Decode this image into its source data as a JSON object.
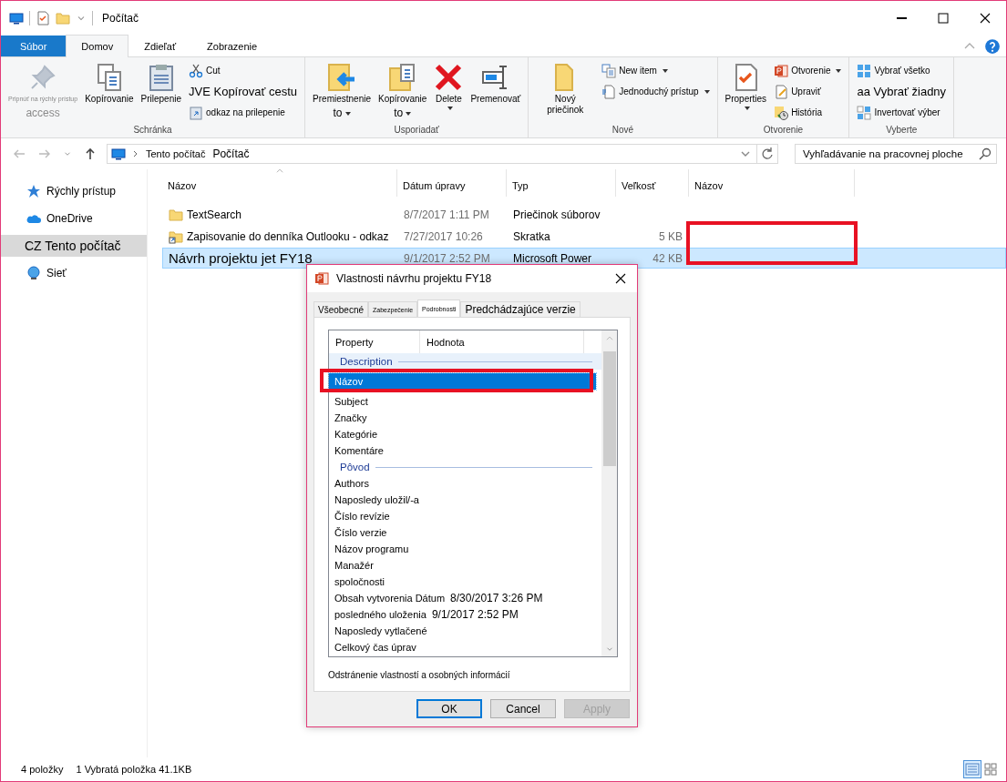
{
  "window": {
    "title": "Počítač"
  },
  "ribbon": {
    "tabs": [
      {
        "label": "Súbor",
        "kind": "file",
        "selected": false
      },
      {
        "label": "Domov",
        "kind": "tab",
        "selected": true
      },
      {
        "label": "Zdieľať",
        "kind": "tab",
        "selected": false
      },
      {
        "label": "Zobrazenie",
        "kind": "tab",
        "selected": false
      }
    ],
    "groups": [
      {
        "name": "Schránka",
        "items": [
          {
            "kind": "large",
            "label": "Pripnúť na rýchly prístup",
            "sublabel": "access",
            "dropdown": false,
            "disabled": true
          },
          {
            "kind": "large",
            "label": "Kopírovanie",
            "dropdown": false,
            "disabled": false
          },
          {
            "kind": "large",
            "label": "Prilepenie",
            "dropdown": false,
            "disabled": false
          },
          {
            "kind": "small",
            "label": "Cut",
            "dropdown": false,
            "disabled": false
          },
          {
            "kind": "small",
            "label": "JVE Kopírovať cestu",
            "dropdown": false,
            "disabled": false
          },
          {
            "kind": "small",
            "label": "odkaz na prilepenie",
            "dropdown": false,
            "disabled": false
          }
        ]
      },
      {
        "name": "Usporiadať",
        "items": [
          {
            "kind": "large",
            "label": "Premiestnenie",
            "sublabel": "to",
            "dropdown": true,
            "disabled": false
          },
          {
            "kind": "large",
            "label": "Kopírovanie",
            "sublabel": "to",
            "dropdown": true,
            "disabled": false
          },
          {
            "kind": "large",
            "label": "Delete",
            "dropdown": true,
            "disabled": false
          },
          {
            "kind": "large",
            "label": "Premenovať",
            "dropdown": false,
            "disabled": false
          }
        ]
      },
      {
        "name": "Nové",
        "items": [
          {
            "kind": "large",
            "label": "Nový priečinok",
            "dropdown": false,
            "disabled": false
          },
          {
            "kind": "small",
            "label": "New item",
            "dropdown": true,
            "disabled": false
          },
          {
            "kind": "small",
            "label": "Jednoduchý prístup",
            "dropdown": true,
            "disabled": false
          }
        ]
      },
      {
        "name": "Otvorenie",
        "items": [
          {
            "kind": "large",
            "label": "Properties",
            "dropdown": true,
            "disabled": false
          },
          {
            "kind": "small",
            "label": "Otvorenie",
            "dropdown": true,
            "disabled": false
          },
          {
            "kind": "small",
            "label": "Upraviť",
            "dropdown": false,
            "disabled": false
          },
          {
            "kind": "small",
            "label": "História",
            "dropdown": false,
            "disabled": false
          }
        ]
      },
      {
        "name": "Vyberte",
        "items": [
          {
            "kind": "small",
            "label": "Vybrať všetko",
            "dropdown": false,
            "disabled": false
          },
          {
            "kind": "small",
            "label": "aa Vybrať žiadny",
            "dropdown": false,
            "disabled": false
          },
          {
            "kind": "small",
            "label": "Invertovať výber",
            "dropdown": false,
            "disabled": false
          }
        ]
      }
    ]
  },
  "address": {
    "crumbs": [
      "Tento počítač",
      "Počítač"
    ]
  },
  "search": {
    "placeholder": "Vyhľadávanie na pracovnej ploche"
  },
  "sidebar": {
    "items": [
      {
        "label": "Rýchly prístup",
        "selected": false
      },
      {
        "label": "OneDrive",
        "selected": false
      },
      {
        "label": "CZ Tento počítač",
        "selected": true
      },
      {
        "label": "Sieť",
        "selected": false
      }
    ]
  },
  "table": {
    "columns": [
      {
        "label": "Názov",
        "sorted": true
      },
      {
        "label": "Dátum úpravy",
        "sorted": false
      },
      {
        "label": "Typ",
        "sorted": false
      },
      {
        "label": "Veľkosť",
        "sorted": false
      },
      {
        "label": "Názov",
        "sorted": false
      }
    ],
    "rows": [
      {
        "kind": "folder",
        "name": "TextSearch",
        "modified": "8/7/2017 1:11 PM",
        "type": "Priečinok súborov",
        "selected": false
      },
      {
        "kind": "shortcut",
        "name": "Zapisovanie do denníka Outlooku - odkaz",
        "modified": "7/27/2017 10:26",
        "type": "Skratka",
        "size": "5 KB",
        "selected": false
      },
      {
        "kind": "document",
        "name": "Návrh projektu jet FY18",
        "modified": "9/1/2017 2:52 PM",
        "type": "Microsoft Power",
        "size": "42 KB",
        "selected": true
      }
    ]
  },
  "status_bar": {
    "count": "4 položky",
    "selection": "1 Vybratá položka 41.1KB"
  },
  "dialog": {
    "title": "Vlastnosti návrhu projektu FY18",
    "tabs": [
      {
        "label": "Všeobecné",
        "selected": false
      },
      {
        "label": "Zabezpečenie",
        "selected": false
      },
      {
        "label": "Podrobnosti",
        "selected": true
      },
      {
        "label": "Predchádzajúce verzie",
        "selected": false
      }
    ],
    "columns": [
      "Property",
      "Hodnota"
    ],
    "rows": [
      {
        "kind": "section",
        "label": "Description",
        "selected": false
      },
      {
        "kind": "property",
        "label": "Názov",
        "selected": true
      },
      {
        "kind": "property",
        "label": "Subject",
        "selected": false
      },
      {
        "kind": "property",
        "label": "Značky",
        "selected": false
      },
      {
        "kind": "property",
        "label": "Kategórie",
        "selected": false
      },
      {
        "kind": "property",
        "label": "Komentáre",
        "selected": false
      },
      {
        "kind": "section",
        "label": "Pôvod",
        "selected": false
      },
      {
        "kind": "property",
        "label": "Authors",
        "selected": false
      },
      {
        "kind": "property",
        "label": "Naposledy uložil/-a",
        "selected": false
      },
      {
        "kind": "property",
        "label": "Číslo revízie",
        "selected": false
      },
      {
        "kind": "property",
        "label": "Číslo verzie",
        "selected": false
      },
      {
        "kind": "property",
        "label": "Názov programu",
        "selected": false
      },
      {
        "kind": "property",
        "label": "Manažér",
        "selected": false
      },
      {
        "kind": "property",
        "label": "spoločnosti",
        "selected": false
      },
      {
        "kind": "property",
        "label": "Obsah vytvorenia Dátum",
        "value": "8/30/2017 3:26 PM",
        "selected": false
      },
      {
        "kind": "property",
        "label": "posledného uloženia",
        "value": "9/1/2017 2:52 PM",
        "selected": false
      },
      {
        "kind": "property",
        "label": "Naposledy vytlačené",
        "selected": false
      },
      {
        "kind": "property",
        "label": "Celkový čas úprav",
        "selected": false
      }
    ],
    "link": "Odstránenie vlastností a osobných informácií",
    "buttons": [
      {
        "label": "OK",
        "kind": "default",
        "disabled": false
      },
      {
        "label": "Cancel",
        "kind": "normal",
        "disabled": false
      },
      {
        "label": "Apply",
        "kind": "normal",
        "disabled": true
      }
    ]
  }
}
